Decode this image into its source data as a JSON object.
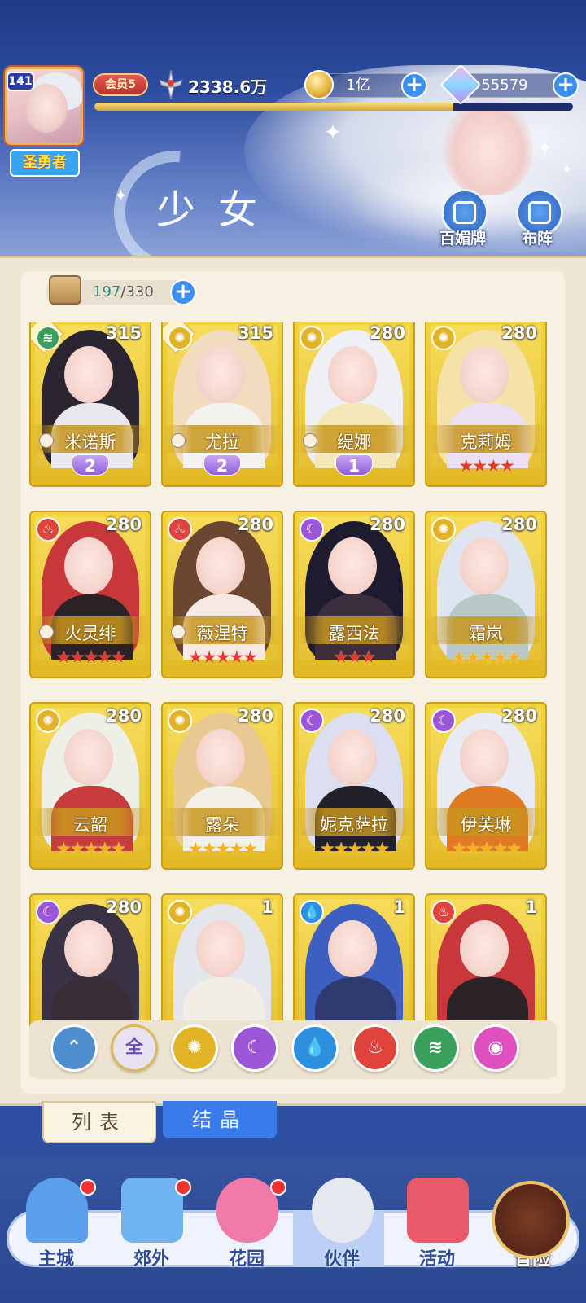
{
  "header": {
    "level": "141",
    "title_badge": "圣勇者",
    "vip": "会员5",
    "power": "2338.6万",
    "exp_progress": 0.75,
    "coins": "1亿",
    "gems": "55579",
    "page_title": "少女",
    "btn_collection": "百媚牌",
    "btn_formation": "布阵"
  },
  "capacity": {
    "current": "197",
    "max": "/330"
  },
  "elements_colors": {
    "wind": "#3aa05c",
    "light": "#e2b425",
    "moon": "#9b57d8",
    "fire": "#e0433b",
    "water": "#2d8fe0",
    "love": "#e04fbf"
  },
  "cards": [
    {
      "name": "米诺斯",
      "level": "315",
      "element": "wind",
      "rank": "2",
      "stars": 0
    },
    {
      "name": "尤拉",
      "level": "315",
      "element": "light",
      "rank": "2",
      "stars": 0
    },
    {
      "name": "缇娜",
      "level": "280",
      "element": "light",
      "rank": "1",
      "stars": 0
    },
    {
      "name": "克莉姆",
      "level": "280",
      "element": "light",
      "rank": "",
      "stars": 4,
      "star_color": "red"
    },
    {
      "name": "火灵绯",
      "level": "280",
      "element": "fire",
      "rank": "",
      "stars": 5,
      "star_color": "red"
    },
    {
      "name": "薇涅特",
      "level": "280",
      "element": "fire",
      "rank": "",
      "stars": 5,
      "star_color": "red"
    },
    {
      "name": "露西法",
      "level": "280",
      "element": "moon",
      "rank": "",
      "stars": 3,
      "star_color": "red"
    },
    {
      "name": "霜岚",
      "level": "280",
      "element": "light",
      "rank": "",
      "stars": 5,
      "star_color": "gold"
    },
    {
      "name": "云韶",
      "level": "280",
      "element": "light",
      "rank": "",
      "stars": 5,
      "star_color": "gold"
    },
    {
      "name": "露朵",
      "level": "280",
      "element": "light",
      "rank": "",
      "stars": 5,
      "star_color": "gold"
    },
    {
      "name": "妮克萨拉",
      "level": "280",
      "element": "moon",
      "rank": "",
      "stars": 5,
      "star_color": "gold"
    },
    {
      "name": "伊芙琳",
      "level": "280",
      "element": "moon",
      "rank": "",
      "stars": 5,
      "star_color": "gold"
    },
    {
      "name": "",
      "level": "280",
      "element": "moon",
      "rank": "",
      "stars": 0
    },
    {
      "name": "",
      "level": "1",
      "element": "light",
      "rank": "",
      "stars": 0
    },
    {
      "name": "",
      "level": "1",
      "element": "water",
      "rank": "",
      "stars": 0
    },
    {
      "name": "",
      "level": "1",
      "element": "fire",
      "rank": "",
      "stars": 0
    }
  ],
  "filters": [
    {
      "name": "type-filter",
      "label": "",
      "color": "#4f8fcf"
    },
    {
      "name": "all-filter",
      "label": "全",
      "color": "#e9e2f3"
    },
    {
      "name": "light-filter",
      "label": "",
      "color": "#e2b425"
    },
    {
      "name": "moon-filter",
      "label": "",
      "color": "#9b57d8"
    },
    {
      "name": "water-filter",
      "label": "",
      "color": "#2d8fe0"
    },
    {
      "name": "fire-filter",
      "label": "",
      "color": "#e0433b"
    },
    {
      "name": "wind-filter",
      "label": "",
      "color": "#3aa05c"
    },
    {
      "name": "love-filter",
      "label": "",
      "color": "#e04fbf"
    }
  ],
  "tabs": {
    "list": "列表",
    "crystal": "结晶"
  },
  "nav": [
    {
      "label": "主城",
      "dot": true
    },
    {
      "label": "郊外",
      "dot": true
    },
    {
      "label": "花园",
      "dot": true
    },
    {
      "label": "伙伴",
      "dot": false
    },
    {
      "label": "活动",
      "dot": false
    },
    {
      "label": "冒险",
      "dot": false
    }
  ]
}
